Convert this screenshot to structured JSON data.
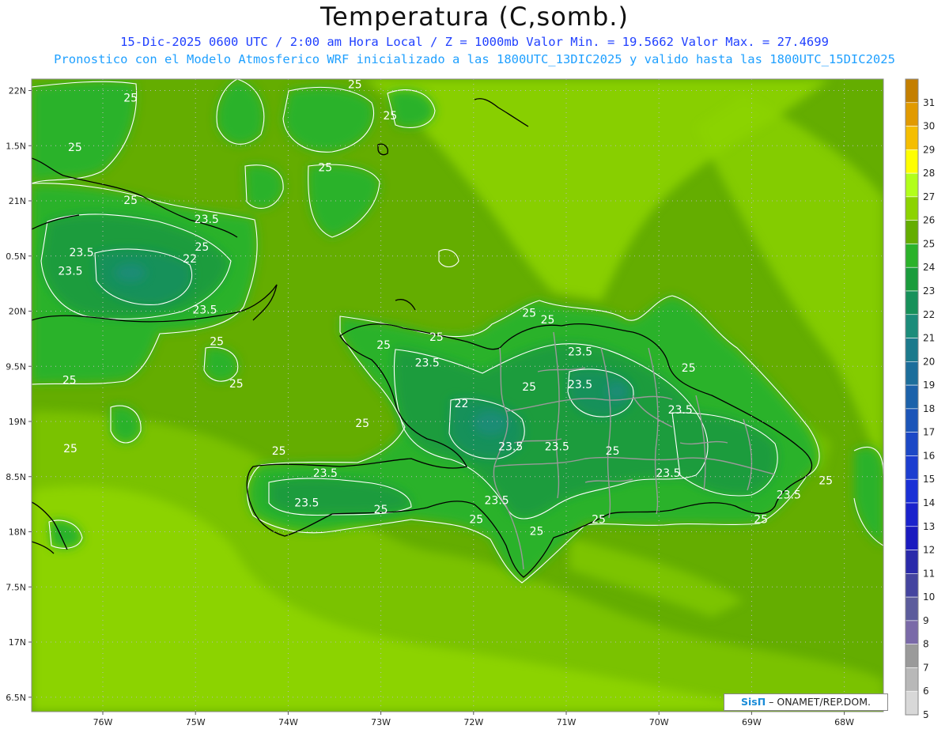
{
  "title": "Temperatura (C,somb.)",
  "subtitle_1": "15-Dic-2025  0600 UTC / 2:00 am Hora Local / Z = 1000mb   Valor Min. = 19.5662  Valor Max. = 27.4699",
  "subtitle_2": "Pronostico con el Modelo Atmosferico WRF inicializado a las 1800UTC_13DIC2025 y valido hasta las  1800UTC_15DIC2025",
  "credit": {
    "brand": "SisΠ",
    "text": " – ONAMET/REP.DOM."
  },
  "colors": {
    "sea_25": "#64ad00",
    "sea_26": "#8cd300",
    "land_24": "#2bb22a",
    "cool_23": "#1a9c3c",
    "cool_22": "#17915a",
    "cold_21": "#1c8c7a",
    "coast": "#000000",
    "border": "#9a9a9a",
    "contour": "#ffffff"
  },
  "chart_data": {
    "type": "heatmap",
    "variable": "Temperatura (C,somb.)",
    "level": "Z = 1000mb",
    "value_min": 19.5662,
    "value_max": 27.4699,
    "x_axis": {
      "ticks": [
        "76W",
        "75W",
        "74W",
        "73W",
        "72W",
        "71W",
        "70W",
        "69W",
        "68W"
      ]
    },
    "y_axis": {
      "ticks": [
        "22N",
        "1.5N",
        "21N",
        "0.5N",
        "20N",
        "9.5N",
        "19N",
        "8.5N",
        "18N",
        "7.5N",
        "17N",
        "6.5N"
      ]
    },
    "colorbar": {
      "labels": [
        "31",
        "30",
        "29",
        "28",
        "27",
        "26",
        "25",
        "24",
        "23",
        "22",
        "21",
        "20",
        "19",
        "18",
        "17",
        "16",
        "15",
        "14",
        "13",
        "12",
        "11",
        "10",
        "9",
        "8",
        "7",
        "6",
        "5"
      ],
      "colors": [
        "#c47f00",
        "#e19a00",
        "#f5be00",
        "#ffff00",
        "#b2ff1a",
        "#8cd300",
        "#64ad00",
        "#2bb22a",
        "#1a9c3c",
        "#17915a",
        "#1c8c7a",
        "#1c7a8c",
        "#1c6e9b",
        "#1c62aa",
        "#1c55b8",
        "#1c48c6",
        "#1c3dd0",
        "#1a30d6",
        "#1a22cc",
        "#1a1abf",
        "#2a2aaa",
        "#44449f",
        "#5c5c9c",
        "#7a6aa8",
        "#9a9a9a",
        "#b8b8b8",
        "#d8d8d8"
      ]
    },
    "contour_labels": [
      {
        "text": "25",
        "lon": -75.7,
        "lat": 21.9
      },
      {
        "text": "25",
        "lon": -73.28,
        "lat": 22.02
      },
      {
        "text": "25",
        "lon": -72.9,
        "lat": 21.74
      },
      {
        "text": "25",
        "lon": -76.3,
        "lat": 21.45
      },
      {
        "text": "25",
        "lon": -73.6,
        "lat": 21.27
      },
      {
        "text": "25",
        "lon": -75.7,
        "lat": 20.97
      },
      {
        "text": "23.5",
        "lon": -74.88,
        "lat": 20.8
      },
      {
        "text": "23.5",
        "lon": -76.23,
        "lat": 20.5
      },
      {
        "text": "22",
        "lon": -75.06,
        "lat": 20.44
      },
      {
        "text": "23.5",
        "lon": -76.35,
        "lat": 20.33
      },
      {
        "text": "25",
        "lon": -74.93,
        "lat": 20.55
      },
      {
        "text": "23.5",
        "lon": -74.9,
        "lat": 19.98
      },
      {
        "text": "25",
        "lon": -74.77,
        "lat": 19.69
      },
      {
        "text": "25",
        "lon": -76.36,
        "lat": 19.34
      },
      {
        "text": "25",
        "lon": -74.56,
        "lat": 19.31
      },
      {
        "text": "25",
        "lon": -72.97,
        "lat": 19.66
      },
      {
        "text": "25",
        "lon": -72.4,
        "lat": 19.73
      },
      {
        "text": "23.5",
        "lon": -72.5,
        "lat": 19.5
      },
      {
        "text": "25",
        "lon": -71.4,
        "lat": 19.95
      },
      {
        "text": "25",
        "lon": -71.2,
        "lat": 19.89
      },
      {
        "text": "23.5",
        "lon": -70.85,
        "lat": 19.6
      },
      {
        "text": "23.5",
        "lon": -70.85,
        "lat": 19.3
      },
      {
        "text": "25",
        "lon": -71.4,
        "lat": 19.28
      },
      {
        "text": "25",
        "lon": -69.68,
        "lat": 19.45
      },
      {
        "text": "22",
        "lon": -72.13,
        "lat": 19.13
      },
      {
        "text": "23.5",
        "lon": -69.77,
        "lat": 19.07
      },
      {
        "text": "25",
        "lon": -73.2,
        "lat": 18.95
      },
      {
        "text": "25",
        "lon": -76.35,
        "lat": 18.72
      },
      {
        "text": "25",
        "lon": -74.1,
        "lat": 18.7
      },
      {
        "text": "23.5",
        "lon": -71.6,
        "lat": 18.74
      },
      {
        "text": "23.5",
        "lon": -71.1,
        "lat": 18.74
      },
      {
        "text": "25",
        "lon": -70.5,
        "lat": 18.7
      },
      {
        "text": "23.5",
        "lon": -73.6,
        "lat": 18.5
      },
      {
        "text": "23.5",
        "lon": -69.9,
        "lat": 18.5
      },
      {
        "text": "23.5",
        "lon": -73.8,
        "lat": 18.23
      },
      {
        "text": "23.5",
        "lon": -71.75,
        "lat": 18.25
      },
      {
        "text": "25",
        "lon": -73.0,
        "lat": 18.17
      },
      {
        "text": "23.5",
        "lon": -68.6,
        "lat": 18.3
      },
      {
        "text": "25",
        "lon": -68.2,
        "lat": 18.43
      },
      {
        "text": "25",
        "lon": -71.97,
        "lat": 18.08
      },
      {
        "text": "25",
        "lon": -70.65,
        "lat": 18.08
      },
      {
        "text": "25",
        "lon": -71.32,
        "lat": 17.97
      },
      {
        "text": "25",
        "lon": -68.9,
        "lat": 18.08
      }
    ]
  }
}
